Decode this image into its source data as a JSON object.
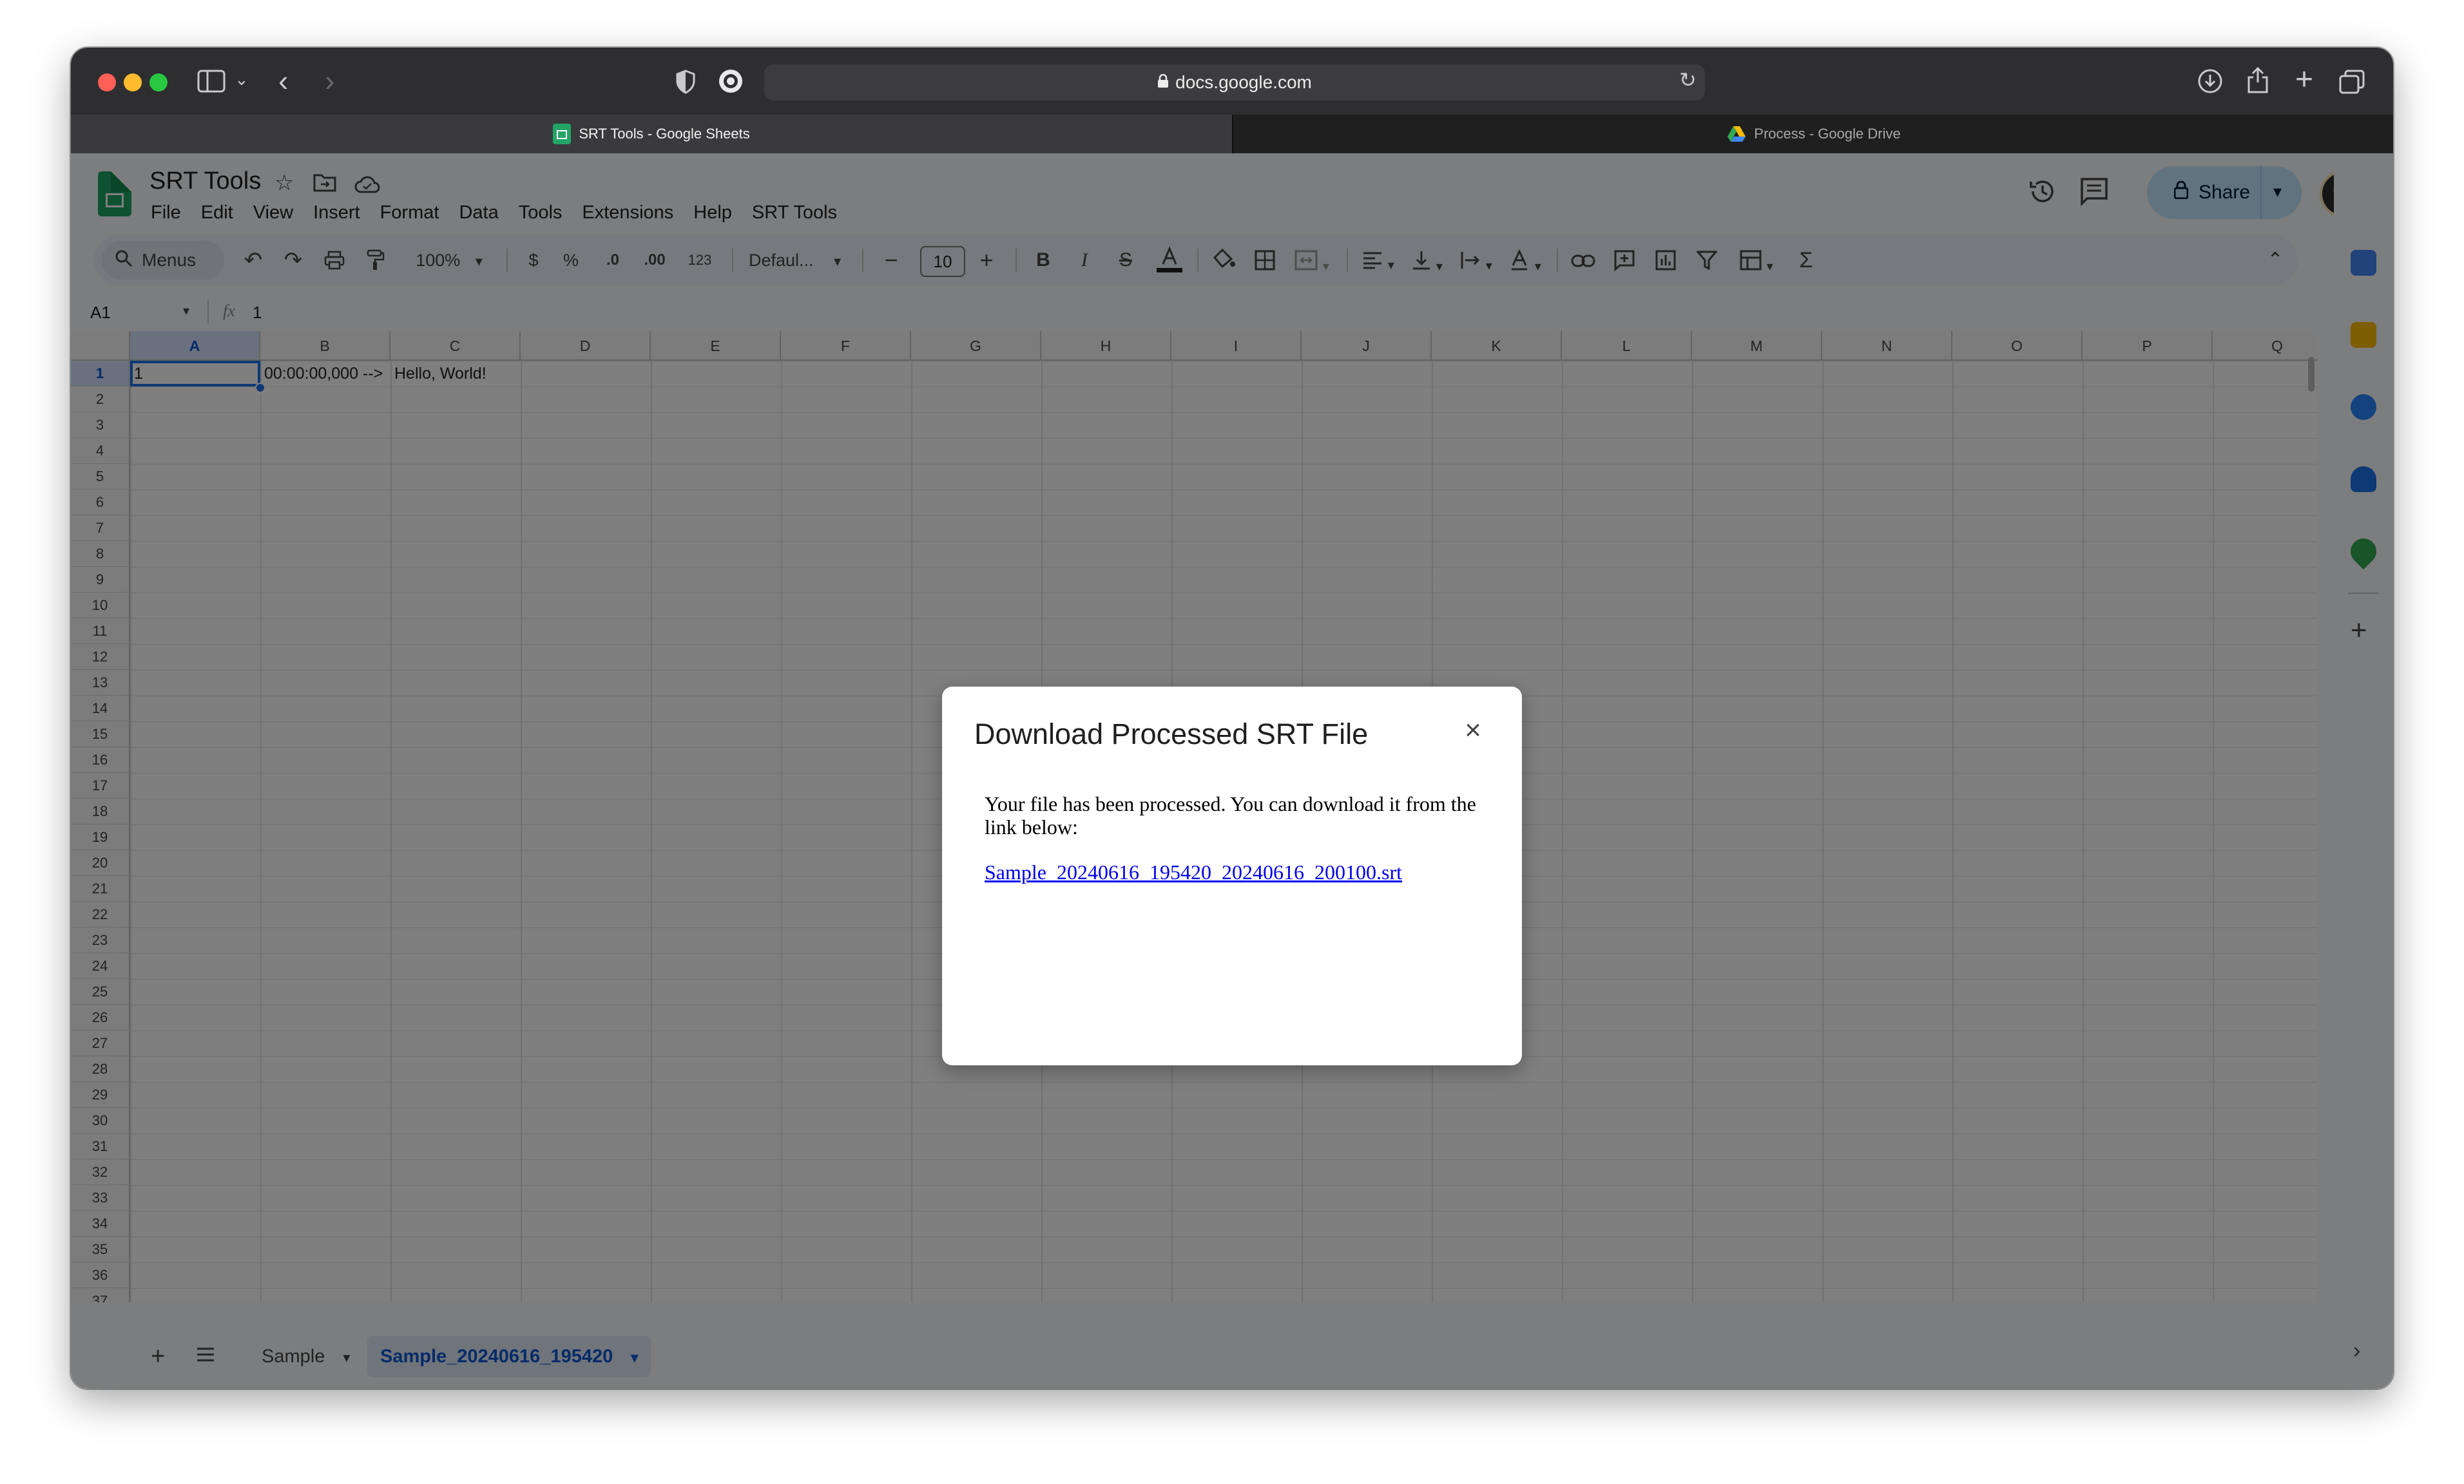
{
  "browser": {
    "url": "docs.google.com",
    "tabs": [
      {
        "title": "SRT Tools - Google Sheets",
        "active": true
      },
      {
        "title": "Process - Google Drive",
        "active": false
      }
    ]
  },
  "sheets": {
    "doc_title": "SRT Tools",
    "menu": [
      "File",
      "Edit",
      "View",
      "Insert",
      "Format",
      "Data",
      "Tools",
      "Extensions",
      "Help",
      "SRT Tools"
    ],
    "share_label": "Share",
    "toolbar": {
      "menus_label": "Menus",
      "zoom": "100%",
      "currency": "$",
      "percent": "%",
      "decrease_decimal": ".0",
      "increase_decimal": ".00",
      "number_format": "123",
      "font": "Defaul...",
      "font_size": "10",
      "bold": "B",
      "italic": "I"
    },
    "name_box": "A1",
    "fx": "fx",
    "formula_value": "1",
    "columns": [
      "A",
      "B",
      "C",
      "D",
      "E",
      "F",
      "G",
      "H",
      "I",
      "J",
      "K",
      "L",
      "M",
      "N",
      "O",
      "P",
      "Q"
    ],
    "rows": [
      "1",
      "2",
      "3",
      "4",
      "5",
      "6",
      "7",
      "8",
      "9",
      "10",
      "11",
      "12",
      "13",
      "14",
      "15",
      "16",
      "17",
      "18",
      "19",
      "20",
      "21",
      "22",
      "23",
      "24",
      "25",
      "26",
      "27",
      "28",
      "29",
      "30",
      "31",
      "32",
      "33",
      "34",
      "35",
      "36",
      "37"
    ],
    "cells": {
      "A1": "1",
      "B1": "00:00:00,000 -->",
      "C1": "Hello, World!"
    },
    "sheet_tabs": [
      {
        "name": "Sample",
        "active": false
      },
      {
        "name": "Sample_20240616_195420",
        "active": true
      }
    ]
  },
  "dialog": {
    "title": "Download Processed SRT File",
    "message": "Your file has been processed. You can download it from the link below:",
    "link_text": "Sample_20240616_195420_20240616_200100.srt"
  },
  "colors": {
    "accent": "#0b57d0",
    "share_bg": "#c2e7ff",
    "sheets_green": "#1fa463",
    "link": "#0000ee"
  }
}
